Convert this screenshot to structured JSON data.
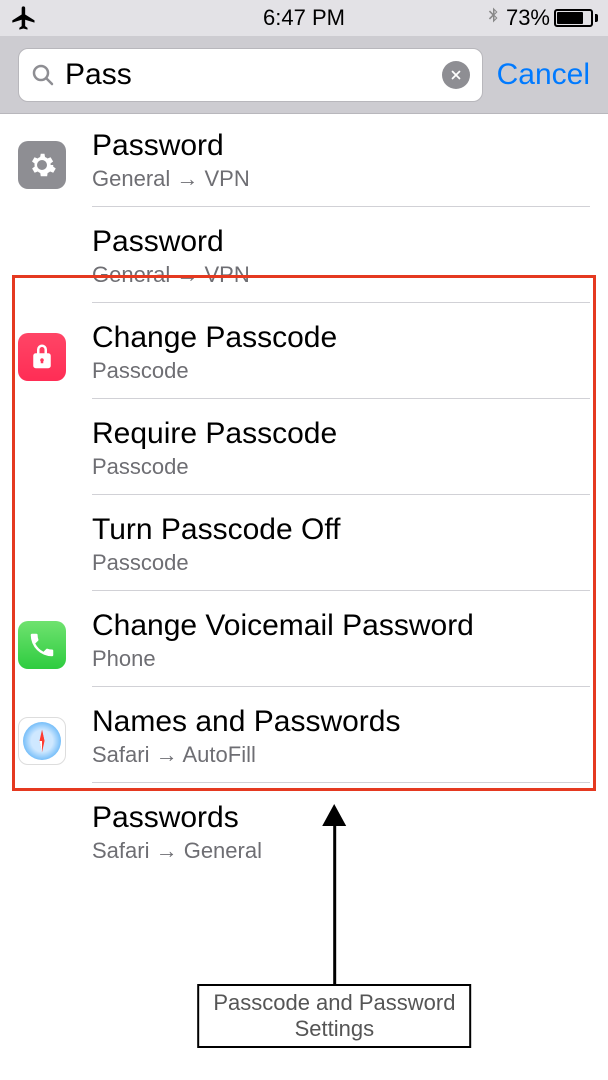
{
  "status": {
    "time": "6:47 PM",
    "battery_percent": "73%"
  },
  "search": {
    "query": "Pass",
    "cancel_label": "Cancel"
  },
  "results": [
    {
      "icon": "gear",
      "title": "Password",
      "path": [
        "General",
        "VPN"
      ]
    },
    {
      "icon": "",
      "title": "Password",
      "path": [
        "General",
        "VPN"
      ]
    },
    {
      "icon": "lock",
      "title": "Change Passcode",
      "path": [
        "Passcode"
      ]
    },
    {
      "icon": "",
      "title": "Require Passcode",
      "path": [
        "Passcode"
      ]
    },
    {
      "icon": "",
      "title": "Turn Passcode Off",
      "path": [
        "Passcode"
      ]
    },
    {
      "icon": "phone",
      "title": "Change Voicemail Password",
      "path": [
        "Phone"
      ]
    },
    {
      "icon": "safari",
      "title": "Names and Passwords",
      "path": [
        "Safari",
        "AutoFill"
      ]
    },
    {
      "icon": "",
      "title": "Passwords",
      "path": [
        "Safari",
        "General"
      ]
    }
  ],
  "annotation": {
    "label": "Passcode and Password Settings"
  },
  "icons": {
    "airplane": "airplane-icon",
    "bluetooth": "bluetooth-icon",
    "search": "search-icon",
    "clear": "clear-icon",
    "gear": "gear-icon",
    "lock": "lock-icon",
    "phone": "phone-icon",
    "safari": "safari-icon"
  }
}
